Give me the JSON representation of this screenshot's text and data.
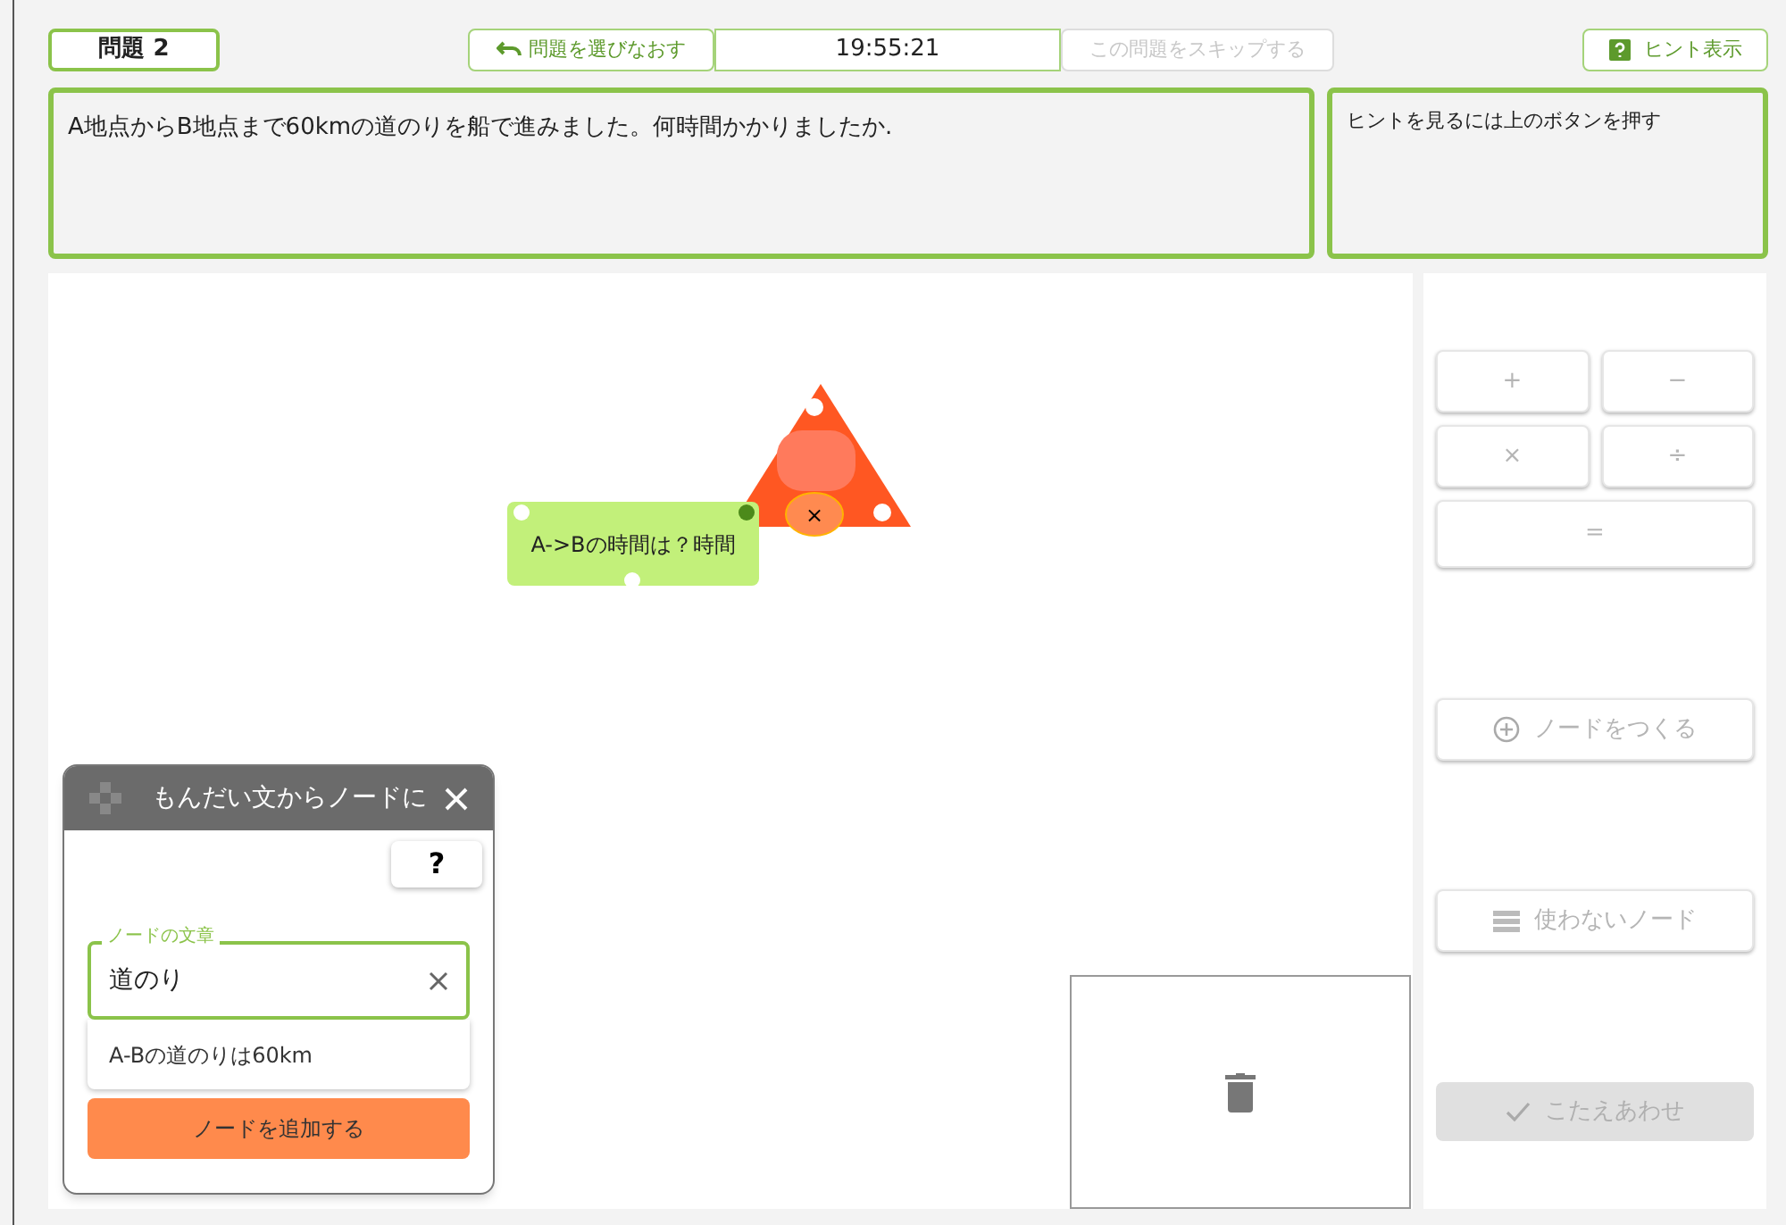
{
  "header": {
    "problem_label": "問題 2",
    "reselect_button": "問題を選びなおす",
    "timer": "19:55:21",
    "skip_button": {
      "label": "この問題をスキップする",
      "disabled": true
    },
    "hint_button": "ヒント表示"
  },
  "problem_text": "A地点からB地点まで60kmの道のりを船で進みました。何時間かかりましたか.",
  "hint_text": "ヒントを見るには上のボタンを押す",
  "canvas": {
    "nodes": [
      {
        "kind": "operator",
        "label": "×"
      },
      {
        "kind": "text",
        "label": "A->Bの時間は？時間"
      }
    ]
  },
  "dialog": {
    "title": "もんだい文からノードに",
    "help_button": "?",
    "field": {
      "label": "ノードの文章",
      "value": "道のり"
    },
    "suggestion": "A-Bの道のりは60km",
    "add_button": "ノードを追加する"
  },
  "sidebar": {
    "operators": [
      {
        "label": "+",
        "disabled": true
      },
      {
        "label": "−",
        "disabled": true
      },
      {
        "label": "×",
        "disabled": true
      },
      {
        "label": "÷",
        "disabled": true
      },
      {
        "label": "=",
        "disabled": true
      }
    ],
    "create_node": {
      "label": "ノードをつくる",
      "disabled": true
    },
    "unused_nodes": {
      "label": "使わないノード",
      "disabled": true
    },
    "check_answer": {
      "label": "こたえあわせ",
      "disabled": true
    }
  }
}
